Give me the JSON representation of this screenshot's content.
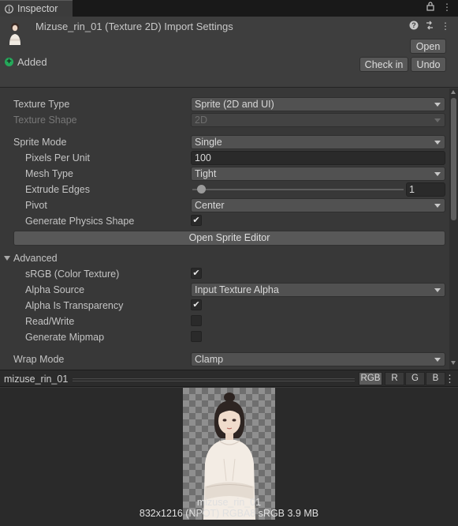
{
  "tab": {
    "label": "Inspector",
    "lock_icon": "lock-icon",
    "menu_icon": "kebab-menu-icon"
  },
  "header": {
    "title": "Mizuse_rin_01 (Texture 2D) Import Settings",
    "open_label": "Open",
    "status": "Added",
    "check_in_label": "Check in",
    "undo_label": "Undo"
  },
  "settings": {
    "texture_type": {
      "label": "Texture Type",
      "value": "Sprite (2D and UI)"
    },
    "texture_shape": {
      "label": "Texture Shape",
      "value": "2D"
    },
    "sprite_mode": {
      "label": "Sprite Mode",
      "value": "Single"
    },
    "pixels_per_unit": {
      "label": "Pixels Per Unit",
      "value": "100"
    },
    "mesh_type": {
      "label": "Mesh Type",
      "value": "Tight"
    },
    "extrude_edges": {
      "label": "Extrude Edges",
      "value": "1",
      "fraction": 0.0625
    },
    "pivot": {
      "label": "Pivot",
      "value": "Center"
    },
    "generate_physics_shape": {
      "label": "Generate Physics Shape",
      "checked": true
    },
    "open_sprite_editor_label": "Open Sprite Editor",
    "advanced_label": "Advanced",
    "srgb": {
      "label": "sRGB (Color Texture)",
      "checked": true
    },
    "alpha_source": {
      "label": "Alpha Source",
      "value": "Input Texture Alpha"
    },
    "alpha_is_transparency": {
      "label": "Alpha Is Transparency",
      "checked": true
    },
    "read_write": {
      "label": "Read/Write",
      "checked": false
    },
    "generate_mipmap": {
      "label": "Generate Mipmap",
      "checked": false
    },
    "wrap_mode": {
      "label": "Wrap Mode",
      "value": "Clamp"
    }
  },
  "preview": {
    "name": "mizuse_rin_01",
    "channels": [
      "RGB",
      "R",
      "G",
      "B"
    ],
    "active_channel": "RGB",
    "caption_name": "mizuse_rin_01",
    "caption_info": "832x1216 (NPOT)  RGBA8 sRGB   3.9 MB"
  },
  "colors": {
    "accent_added": "#25a85a",
    "panel_bg": "#383838"
  }
}
